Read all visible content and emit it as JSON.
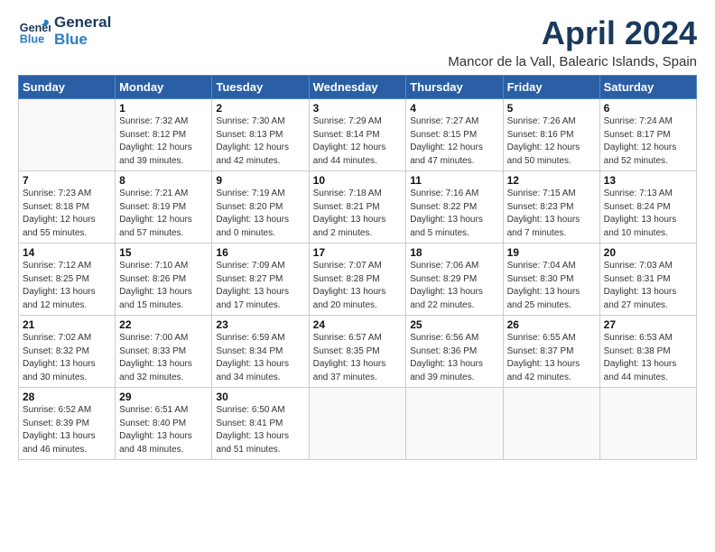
{
  "header": {
    "logo_general": "General",
    "logo_blue": "Blue",
    "title": "April 2024",
    "subtitle": "Mancor de la Vall, Balearic Islands, Spain"
  },
  "weekdays": [
    "Sunday",
    "Monday",
    "Tuesday",
    "Wednesday",
    "Thursday",
    "Friday",
    "Saturday"
  ],
  "days": [
    {
      "date": "",
      "info": ""
    },
    {
      "date": "1",
      "info": "Sunrise: 7:32 AM\nSunset: 8:12 PM\nDaylight: 12 hours\nand 39 minutes."
    },
    {
      "date": "2",
      "info": "Sunrise: 7:30 AM\nSunset: 8:13 PM\nDaylight: 12 hours\nand 42 minutes."
    },
    {
      "date": "3",
      "info": "Sunrise: 7:29 AM\nSunset: 8:14 PM\nDaylight: 12 hours\nand 44 minutes."
    },
    {
      "date": "4",
      "info": "Sunrise: 7:27 AM\nSunset: 8:15 PM\nDaylight: 12 hours\nand 47 minutes."
    },
    {
      "date": "5",
      "info": "Sunrise: 7:26 AM\nSunset: 8:16 PM\nDaylight: 12 hours\nand 50 minutes."
    },
    {
      "date": "6",
      "info": "Sunrise: 7:24 AM\nSunset: 8:17 PM\nDaylight: 12 hours\nand 52 minutes."
    },
    {
      "date": "7",
      "info": "Sunrise: 7:23 AM\nSunset: 8:18 PM\nDaylight: 12 hours\nand 55 minutes."
    },
    {
      "date": "8",
      "info": "Sunrise: 7:21 AM\nSunset: 8:19 PM\nDaylight: 12 hours\nand 57 minutes."
    },
    {
      "date": "9",
      "info": "Sunrise: 7:19 AM\nSunset: 8:20 PM\nDaylight: 13 hours\nand 0 minutes."
    },
    {
      "date": "10",
      "info": "Sunrise: 7:18 AM\nSunset: 8:21 PM\nDaylight: 13 hours\nand 2 minutes."
    },
    {
      "date": "11",
      "info": "Sunrise: 7:16 AM\nSunset: 8:22 PM\nDaylight: 13 hours\nand 5 minutes."
    },
    {
      "date": "12",
      "info": "Sunrise: 7:15 AM\nSunset: 8:23 PM\nDaylight: 13 hours\nand 7 minutes."
    },
    {
      "date": "13",
      "info": "Sunrise: 7:13 AM\nSunset: 8:24 PM\nDaylight: 13 hours\nand 10 minutes."
    },
    {
      "date": "14",
      "info": "Sunrise: 7:12 AM\nSunset: 8:25 PM\nDaylight: 13 hours\nand 12 minutes."
    },
    {
      "date": "15",
      "info": "Sunrise: 7:10 AM\nSunset: 8:26 PM\nDaylight: 13 hours\nand 15 minutes."
    },
    {
      "date": "16",
      "info": "Sunrise: 7:09 AM\nSunset: 8:27 PM\nDaylight: 13 hours\nand 17 minutes."
    },
    {
      "date": "17",
      "info": "Sunrise: 7:07 AM\nSunset: 8:28 PM\nDaylight: 13 hours\nand 20 minutes."
    },
    {
      "date": "18",
      "info": "Sunrise: 7:06 AM\nSunset: 8:29 PM\nDaylight: 13 hours\nand 22 minutes."
    },
    {
      "date": "19",
      "info": "Sunrise: 7:04 AM\nSunset: 8:30 PM\nDaylight: 13 hours\nand 25 minutes."
    },
    {
      "date": "20",
      "info": "Sunrise: 7:03 AM\nSunset: 8:31 PM\nDaylight: 13 hours\nand 27 minutes."
    },
    {
      "date": "21",
      "info": "Sunrise: 7:02 AM\nSunset: 8:32 PM\nDaylight: 13 hours\nand 30 minutes."
    },
    {
      "date": "22",
      "info": "Sunrise: 7:00 AM\nSunset: 8:33 PM\nDaylight: 13 hours\nand 32 minutes."
    },
    {
      "date": "23",
      "info": "Sunrise: 6:59 AM\nSunset: 8:34 PM\nDaylight: 13 hours\nand 34 minutes."
    },
    {
      "date": "24",
      "info": "Sunrise: 6:57 AM\nSunset: 8:35 PM\nDaylight: 13 hours\nand 37 minutes."
    },
    {
      "date": "25",
      "info": "Sunrise: 6:56 AM\nSunset: 8:36 PM\nDaylight: 13 hours\nand 39 minutes."
    },
    {
      "date": "26",
      "info": "Sunrise: 6:55 AM\nSunset: 8:37 PM\nDaylight: 13 hours\nand 42 minutes."
    },
    {
      "date": "27",
      "info": "Sunrise: 6:53 AM\nSunset: 8:38 PM\nDaylight: 13 hours\nand 44 minutes."
    },
    {
      "date": "28",
      "info": "Sunrise: 6:52 AM\nSunset: 8:39 PM\nDaylight: 13 hours\nand 46 minutes."
    },
    {
      "date": "29",
      "info": "Sunrise: 6:51 AM\nSunset: 8:40 PM\nDaylight: 13 hours\nand 48 minutes."
    },
    {
      "date": "30",
      "info": "Sunrise: 6:50 AM\nSunset: 8:41 PM\nDaylight: 13 hours\nand 51 minutes."
    },
    {
      "date": "",
      "info": ""
    },
    {
      "date": "",
      "info": ""
    },
    {
      "date": "",
      "info": ""
    },
    {
      "date": "",
      "info": ""
    }
  ]
}
